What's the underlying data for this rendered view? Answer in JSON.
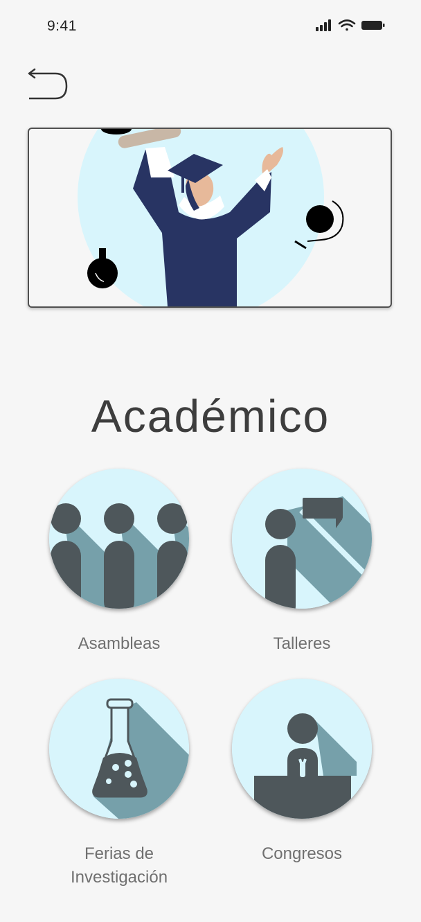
{
  "status_bar": {
    "time": "9:41",
    "icons": [
      "signal-icon",
      "wifi-icon",
      "battery-icon"
    ]
  },
  "header": {
    "back_icon": "back-arrow-icon"
  },
  "hero": {
    "illustration": "graduate-illustration"
  },
  "page": {
    "title": "Académico"
  },
  "categories": [
    {
      "label": "Asambleas",
      "icon": "assembly-icon"
    },
    {
      "label": "Talleres",
      "icon": "workshop-icon"
    },
    {
      "label": "Ferias de Investigación",
      "icon": "flask-icon"
    },
    {
      "label": "Congresos",
      "icon": "podium-icon"
    }
  ],
  "colors": {
    "background": "#f6f6f6",
    "circle_bg": "#d8f5fc",
    "icon_dark": "#4e575b",
    "icon_shadow": "#76a0aa",
    "gown": "#283463",
    "title": "#3d3d3d",
    "label": "#707070"
  }
}
